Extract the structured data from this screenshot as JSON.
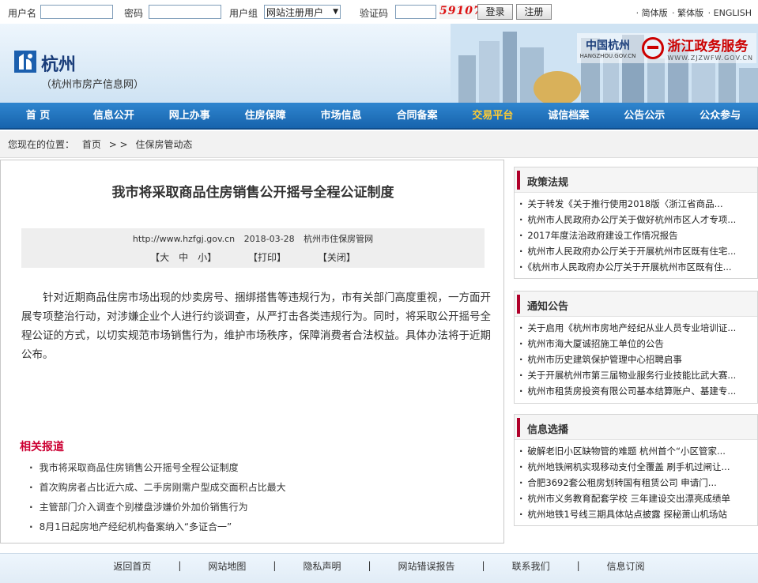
{
  "login": {
    "username_label": "用户名",
    "password_label": "密码",
    "group_label": "用户组",
    "group_value": "网站注册用户",
    "captcha_label": "验证码",
    "captcha_code": "59107",
    "login_button": "登录",
    "register_button": "注册",
    "lang_simplified": "· 简体版",
    "lang_traditional": "· 繁体版",
    "lang_english": "· ENGLISH"
  },
  "header": {
    "site_name": "杭州",
    "site_subtitle": "（杭州市房产信息网）",
    "hz_logo_text": "中国杭州",
    "hz_logo_sub": "HANGZHOU.GOV.CN",
    "zj_logo_text": "浙江政务服务",
    "zj_logo_sub": "WWW.ZJZWFW.GOV.CN"
  },
  "nav": {
    "items": [
      "首 页",
      "信息公开",
      "网上办事",
      "住房保障",
      "市场信息",
      "合同备案",
      "交易平台",
      "诚信档案",
      "公告公示",
      "公众参与"
    ],
    "active_index": 6,
    "active_color": "#ffcc33"
  },
  "breadcrumb": {
    "prefix": "您现在的位置：",
    "home": "首页",
    "sep": "> >",
    "current": "住保房管动态"
  },
  "article": {
    "title": "我市将采取商品住房销售公开摇号全程公证制度",
    "url": "http://www.hzfgj.gov.cn",
    "date": "2018-03-28",
    "source": "杭州市住保房管网",
    "font_sizes": "【大　中　小】",
    "print": "【打印】",
    "close": "【关闭】",
    "body": "针对近期商品住房市场出现的炒卖房号、捆绑搭售等违规行为，市有关部门高度重视，一方面开展专项整治行动，对涉嫌企业个人进行约谈调查，从严打击各类违规行为。同时，将采取公开摇号全程公证的方式，以切实规范市场销售行为，维护市场秩序，保障消费者合法权益。具体办法将于近期公布。"
  },
  "related": {
    "title": "相关报道",
    "items": [
      "我市将采取商品住房销售公开摇号全程公证制度",
      "首次购房者占比近六成、二手房刚需户型成交面积占比最大",
      "主管部门介入调查个别楼盘涉嫌价外加价销售行为",
      "8月1日起房地产经纪机构备案纳入“多证合一”"
    ]
  },
  "sidebar": {
    "policy": {
      "title": "政策法规",
      "items": [
        "关于转发《关于推行使用2018版〈浙江省商品...",
        "杭州市人民政府办公厅关于做好杭州市区人才专项...",
        "2017年度法治政府建设工作情况报告",
        "杭州市人民政府办公厅关于开展杭州市区既有住宅...",
        "《杭州市人民政府办公厅关于开展杭州市区既有住..."
      ]
    },
    "notice": {
      "title": "通知公告",
      "items": [
        "关于启用《杭州市房地产经纪从业人员专业培训证...",
        "杭州市海大厦诚招施工单位的公告",
        "杭州市历史建筑保护管理中心招聘启事",
        "关于开展杭州市第三届物业服务行业技能比武大赛...",
        "杭州市租赁房投资有限公司基本结算账户、基建专..."
      ]
    },
    "info": {
      "title": "信息选播",
      "items": [
        "破解老旧小区缺物管的难题 杭州首个“小区管家...",
        "杭州地铁闸机实现移动支付全覆盖 刷手机过闸让...",
        "合肥3692套公租房划转国有租赁公司 申请门...",
        "杭州市义务教育配套学校 三年建设交出漂亮成绩单",
        "杭州地铁1号线三期具体站点披露 探秘萧山机场站"
      ]
    }
  },
  "footer": {
    "links": [
      "返回首页",
      "网站地图",
      "隐私声明",
      "网站错误报告",
      "联系我们",
      "信息订阅"
    ],
    "separator": "|"
  }
}
